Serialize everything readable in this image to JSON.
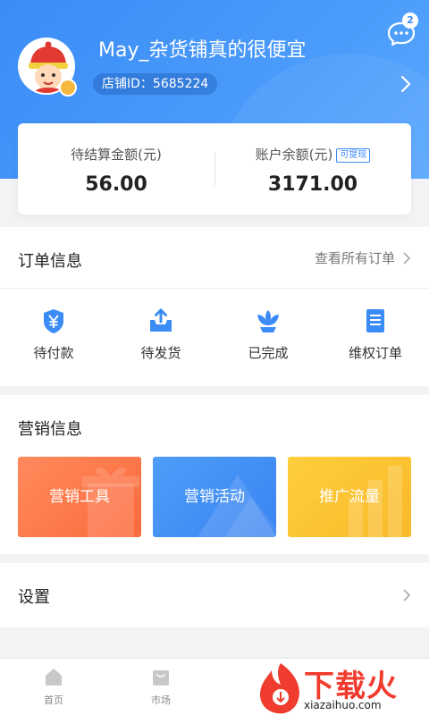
{
  "header": {
    "shop_name": "May_杂货铺真的很便宜",
    "shop_id_label": "店铺ID：5685224",
    "message_count": "2",
    "accent": "#3b8cf6"
  },
  "balance": {
    "pending_label": "待结算金额(元)",
    "pending_value": "56.00",
    "account_label": "账户余额(元)",
    "withdraw_tag": "可提现",
    "account_value": "3171.00"
  },
  "orders": {
    "title": "订单信息",
    "view_all": "查看所有订单",
    "items": [
      {
        "label": "待付款",
        "icon": "yuan-shield-icon"
      },
      {
        "label": "待发货",
        "icon": "upload-box-icon"
      },
      {
        "label": "已完成",
        "icon": "lotus-icon"
      },
      {
        "label": "维权订单",
        "icon": "document-list-icon"
      }
    ]
  },
  "marketing": {
    "title": "营销信息",
    "cards": [
      {
        "label": "营销工具",
        "color": "#fb6b3d"
      },
      {
        "label": "营销活动",
        "color": "#3a84f2"
      },
      {
        "label": "推广流量",
        "color": "#f9b92a"
      }
    ]
  },
  "settings": {
    "title": "设置"
  },
  "tabbar": {
    "items": [
      {
        "label": "首页",
        "icon": "home-icon"
      },
      {
        "label": "市场",
        "icon": "shopping-bag-icon"
      }
    ]
  },
  "watermark": {
    "text": "下载火",
    "url": "xiazaihuo.com"
  }
}
